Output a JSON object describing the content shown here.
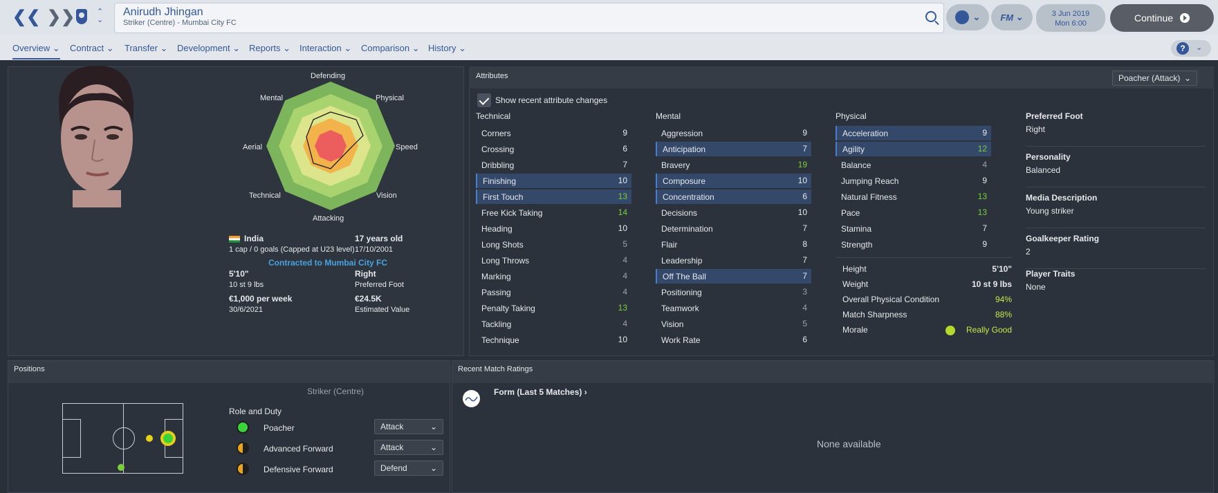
{
  "player": {
    "name": "Anirudh Jhingan",
    "role_club": "Striker (Centre) - Mumbai City FC"
  },
  "top": {
    "date": "3 Jun 2019",
    "time": "Mon 6:00",
    "continue": "Continue",
    "fm_label": "FM"
  },
  "menu": [
    "Overview",
    "Contract",
    "Transfer",
    "Development",
    "Reports",
    "Interaction",
    "Comparison",
    "History"
  ],
  "radar_labels": {
    "top": "Defending",
    "tr": "Physical",
    "r": "Speed",
    "br": "Vision",
    "bottom": "Attacking",
    "bl": "Technical",
    "l": "Aerial",
    "tl": "Mental"
  },
  "bio": {
    "nation": "India",
    "caps": "1 cap / 0 goals (Capped at U23 level)",
    "age": "17 years old",
    "dob": "17/10/2001",
    "height": "5'10\"",
    "weight": "10 st 9 lbs",
    "foot": "Right",
    "foot_label": "Preferred Foot",
    "wage": "€1,000 per week",
    "contract_end": "30/6/2021",
    "value": "€24.5K",
    "value_label": "Estimated Value",
    "contracted": "Contracted to Mumbai City FC"
  },
  "attributes": {
    "title": "Attributes",
    "role_select": "Poacher (Attack)",
    "show_changes": "Show recent attribute changes",
    "technical_title": "Technical",
    "mental_title": "Mental",
    "physical_title": "Physical",
    "technical": [
      [
        "Corners",
        "9",
        ""
      ],
      [
        "Crossing",
        "6",
        ""
      ],
      [
        "Dribbling",
        "7",
        ""
      ],
      [
        "Finishing",
        "10",
        "hl"
      ],
      [
        "First Touch",
        "13",
        "hlg"
      ],
      [
        "Free Kick Taking",
        "14",
        "g"
      ],
      [
        "Heading",
        "10",
        ""
      ],
      [
        "Long Shots",
        "5",
        "gray"
      ],
      [
        "Long Throws",
        "4",
        "gray"
      ],
      [
        "Marking",
        "4",
        "gray"
      ],
      [
        "Passing",
        "4",
        "gray"
      ],
      [
        "Penalty Taking",
        "13",
        "g"
      ],
      [
        "Tackling",
        "4",
        "gray"
      ],
      [
        "Technique",
        "10",
        ""
      ]
    ],
    "mental": [
      [
        "Aggression",
        "9",
        ""
      ],
      [
        "Anticipation",
        "7",
        "hl"
      ],
      [
        "Bravery",
        "19",
        "g"
      ],
      [
        "Composure",
        "10",
        "hl"
      ],
      [
        "Concentration",
        "6",
        "hl"
      ],
      [
        "Decisions",
        "10",
        ""
      ],
      [
        "Determination",
        "7",
        ""
      ],
      [
        "Flair",
        "8",
        ""
      ],
      [
        "Leadership",
        "7",
        ""
      ],
      [
        "Off The Ball",
        "7",
        "hl"
      ],
      [
        "Positioning",
        "3",
        "gray"
      ],
      [
        "Teamwork",
        "4",
        "gray"
      ],
      [
        "Vision",
        "5",
        "gray"
      ],
      [
        "Work Rate",
        "6",
        ""
      ]
    ],
    "physical": [
      [
        "Acceleration",
        "9",
        "hl"
      ],
      [
        "Agility",
        "12",
        "hlg"
      ],
      [
        "Balance",
        "4",
        "gray"
      ],
      [
        "Jumping Reach",
        "9",
        ""
      ],
      [
        "Natural Fitness",
        "13",
        "g"
      ],
      [
        "Pace",
        "13",
        "g"
      ],
      [
        "Stamina",
        "7",
        ""
      ],
      [
        "Strength",
        "9",
        ""
      ]
    ]
  },
  "physstats": [
    [
      "Height",
      "5'10\""
    ],
    [
      "Weight",
      "10 st 9 lbs"
    ],
    [
      "Overall Physical Condition",
      "94%"
    ],
    [
      "Match Sharpness",
      "88%"
    ],
    [
      "Morale",
      "Really Good"
    ]
  ],
  "side": [
    [
      "Preferred Foot",
      "Right"
    ],
    [
      "Personality",
      "Balanced"
    ],
    [
      "Media Description",
      "Young striker"
    ],
    [
      "Goalkeeper Rating",
      "2"
    ],
    [
      "Player Traits",
      "None"
    ]
  ],
  "positions": {
    "title": "Positions",
    "pos": "Striker (Centre)",
    "role_duty": "Role and Duty",
    "roles": [
      [
        "Poacher",
        "Attack"
      ],
      [
        "Advanced Forward",
        "Attack"
      ],
      [
        "Defensive Forward",
        "Defend"
      ]
    ]
  },
  "ratings": {
    "title": "Recent Match Ratings",
    "form": "Form (Last 5 Matches)",
    "none": "None available"
  },
  "watermark": "MUMBAI CITY FC"
}
